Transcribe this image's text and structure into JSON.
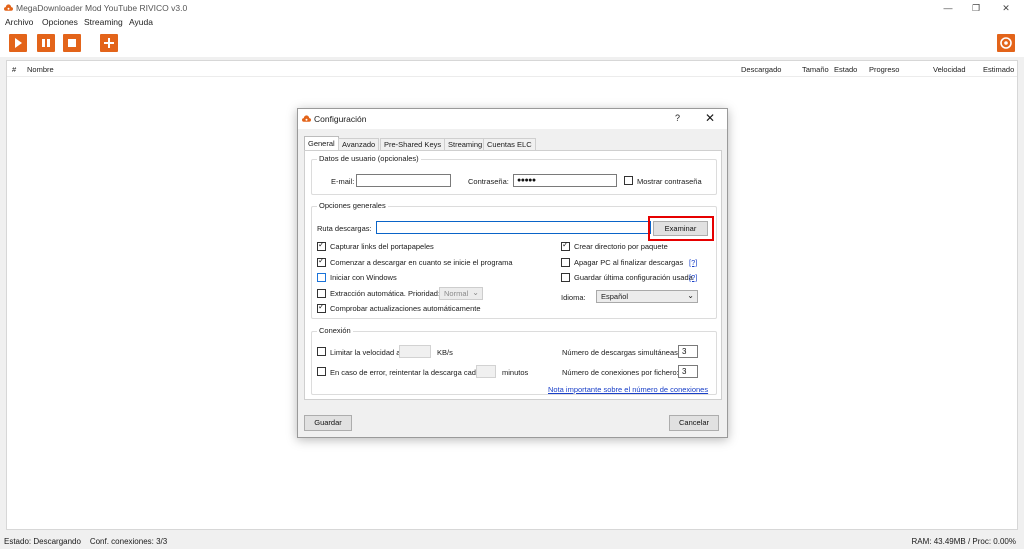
{
  "window": {
    "title": "MegaDownloader Mod YouTube RIVICO v3.0",
    "controls": {
      "minimize": "—",
      "restore": "❐",
      "close": "✕"
    }
  },
  "menu": [
    "Archivo",
    "Opciones",
    "Streaming",
    "Ayuda"
  ],
  "toolbar": {
    "accent": "#e3641a",
    "buttons": [
      "play-icon",
      "pause-icon",
      "stop-icon",
      "add-icon"
    ],
    "right_button": "settings-target-icon"
  },
  "list": {
    "columns": [
      "#",
      "Nombre",
      "Descargado",
      "Tamaño",
      "Estado",
      "Progreso",
      "Velocidad",
      "Estimado"
    ]
  },
  "status": {
    "left": "Estado: Descargando    Conf. conexiones: 3/3",
    "right": "RAM: 43.49MB / Proc: 0.00%"
  },
  "dialog": {
    "title": "Configuración",
    "help": "?",
    "close": "✕",
    "tabs": [
      "General",
      "Avanzado",
      "Pre-Shared Keys",
      "Streaming",
      "Cuentas ELC"
    ],
    "active_tab": "General",
    "user_data": {
      "group": "Datos de usuario (opcionales)",
      "email_label": "E-mail:",
      "email_value": "",
      "password_label": "Contraseña:",
      "password_value": "●●●●●",
      "show_password": "Mostrar contraseña"
    },
    "general": {
      "group": "Opciones generales",
      "path_label": "Ruta descargas:",
      "path_value": "",
      "browse_button": "Examinar",
      "options_left": [
        {
          "label": "Capturar links del portapapeles",
          "checked": true
        },
        {
          "label": "Comenzar a descargar en cuanto se inicie el programa",
          "checked": true
        },
        {
          "label": "Iniciar con Windows",
          "checked": false
        },
        {
          "label": "Extracción automática. Prioridad:",
          "checked": false
        },
        {
          "label": "Comprobar actualizaciones automáticamente",
          "checked": true
        }
      ],
      "priority_value": "Normal",
      "options_right": [
        {
          "label": "Crear directorio por paquete",
          "checked": true
        },
        {
          "label": "Apagar PC al finalizar descargas",
          "checked": false,
          "help": "[?]"
        },
        {
          "label": "Guardar última configuración usada",
          "checked": false,
          "help": "[?]"
        }
      ],
      "language_label": "Idioma:",
      "language_value": "Español"
    },
    "connection": {
      "group": "Conexión",
      "limit_label": "Limitar la velocidad a",
      "limit_unit": "KB/s",
      "retry_label": "En caso de error, reintentar la descarga cada",
      "retry_unit": "minutos",
      "simultaneous_label": "Número de descargas simultáneas:",
      "simultaneous_value": "3",
      "per_file_label": "Número de conexiones por fichero:",
      "per_file_value": "3",
      "note_link": "Nota importante sobre el número de conexiones"
    },
    "save_button": "Guardar",
    "cancel_button": "Cancelar",
    "highlight_color": "#e60000"
  }
}
